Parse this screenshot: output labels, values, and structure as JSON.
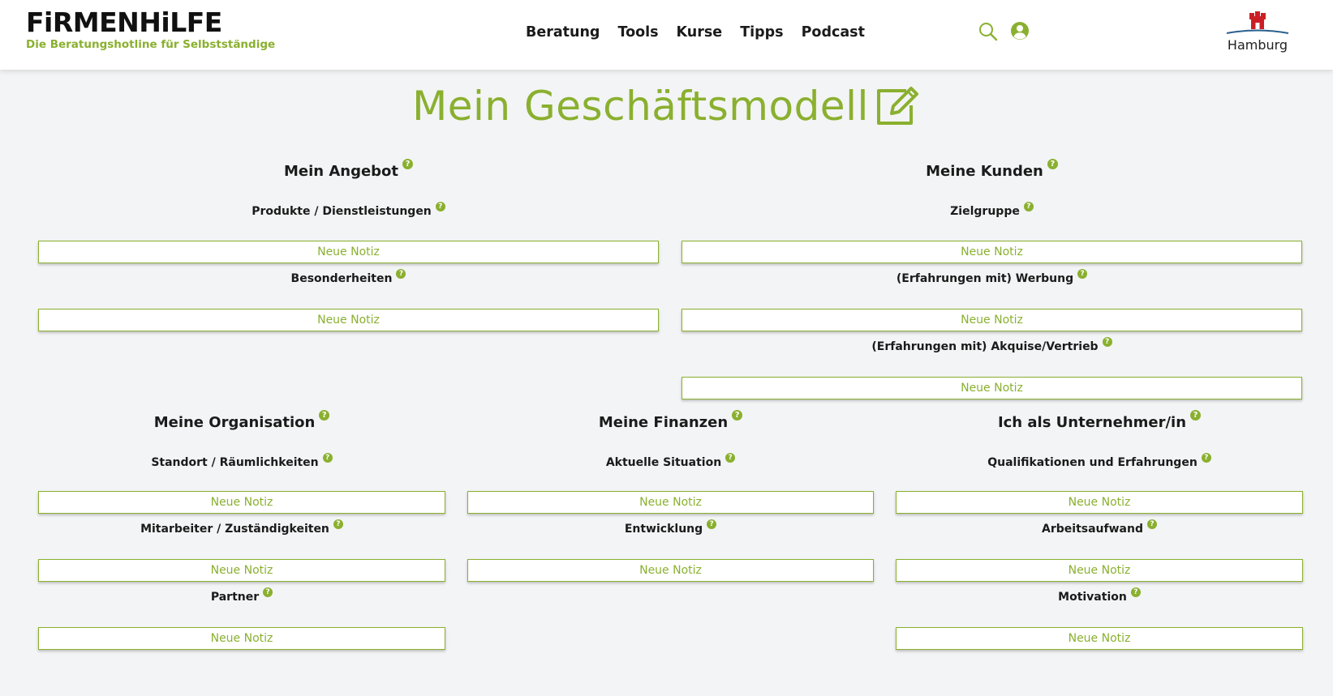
{
  "header": {
    "logo_main": "FiRMENHiLFE",
    "logo_sub": "Die Beratungshotline für Selbstständige",
    "nav": [
      "Beratung",
      "Tools",
      "Kurse",
      "Tipps",
      "Podcast"
    ],
    "city": "Hamburg"
  },
  "page": {
    "title": "Mein Geschäftsmodell"
  },
  "note_label": "Neue Notiz",
  "help_glyph": "?",
  "sections": {
    "angebot": {
      "heading": "Mein Angebot",
      "fields": [
        "Produkte / Dienstleistungen",
        "Besonderheiten"
      ]
    },
    "kunden": {
      "heading": "Meine Kunden",
      "fields": [
        "Zielgruppe",
        "(Erfahrungen mit) Werbung",
        "(Erfahrungen mit) Akquise/Vertrieb"
      ]
    },
    "organisation": {
      "heading": "Meine Organisation",
      "fields": [
        "Standort / Räumlichkeiten",
        "Mitarbeiter / Zuständigkeiten",
        "Partner"
      ]
    },
    "finanzen": {
      "heading": "Meine Finanzen",
      "fields": [
        "Aktuelle Situation",
        "Entwicklung"
      ]
    },
    "unternehmer": {
      "heading": "Ich als Unternehmer/in",
      "fields": [
        "Qualifikationen und Erfahrungen",
        "Arbeitsaufwand",
        "Motivation"
      ]
    }
  },
  "colors": {
    "accent": "#8ab02f",
    "text": "#1b1b1b",
    "background": "#f3f4f5"
  }
}
